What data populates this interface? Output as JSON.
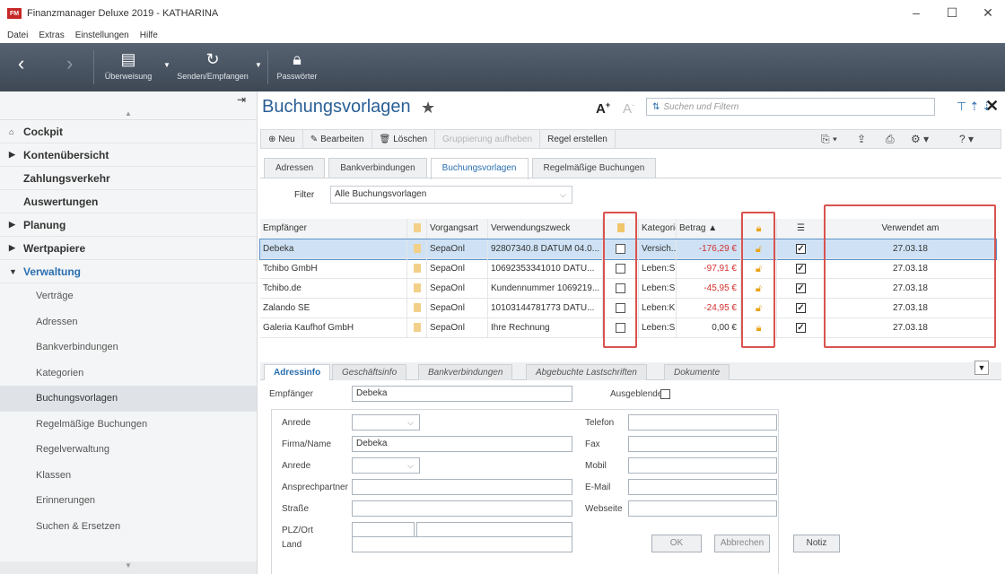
{
  "window": {
    "title": "Finanzmanager Deluxe 2019 - KATHARINA",
    "logo": "FM"
  },
  "menu": [
    "Datei",
    "Extras",
    "Einstellungen",
    "Hilfe"
  ],
  "toolbar": {
    "buttons": [
      {
        "label": "Überweisung",
        "icon": "transfer-icon"
      },
      {
        "label": "Senden/Empfangen",
        "icon": "sync-icon"
      },
      {
        "label": "Passwörter",
        "icon": "lock-icon"
      }
    ]
  },
  "sidebar": {
    "main": [
      {
        "label": "Cockpit",
        "icon": "home-icon"
      },
      {
        "label": "Kontenübersicht"
      },
      {
        "label": "Zahlungsverkehr"
      },
      {
        "label": "Auswertungen"
      },
      {
        "label": "Planung"
      },
      {
        "label": "Wertpapiere"
      },
      {
        "label": "Verwaltung"
      }
    ],
    "sub": [
      "Verträge",
      "Adressen",
      "Bankverbindungen",
      "Kategorien",
      "Buchungsvorlagen",
      "Regelmäßige Buchungen",
      "Regelverwaltung",
      "Klassen",
      "Erinnerungen",
      "Suchen & Ersetzen"
    ],
    "selected": "Buchungsvorlagen"
  },
  "page": {
    "title": "Buchungsvorlagen",
    "font_up": "A",
    "font_down": "A",
    "search_placeholder": "Suchen und Filtern"
  },
  "actions": {
    "new": "Neu",
    "edit": "Bearbeiten",
    "delete": "Löschen",
    "disabled": "Gruppierung aufheben",
    "rule": "Regel erstellen"
  },
  "tabs": [
    "Adressen",
    "Bankverbindungen",
    "Buchungsvorlagen",
    "Regelmäßige Buchungen"
  ],
  "active_tab": "Buchungsvorlagen",
  "filter": {
    "label": "Filter",
    "value": "Alle Buchungsvorlagen"
  },
  "table": {
    "headers": {
      "recipient": "Empfänger",
      "type": "Vorgangsart",
      "purpose": "Verwendungszweck",
      "category": "Kategorie",
      "amount": "Betrag ▲",
      "used": "Verwendet am"
    },
    "rows": [
      {
        "recipient": "Debeka",
        "type": "SepaOnl",
        "purpose": "92807340.8 DATUM 04.0...",
        "category": "Versich...",
        "amount": "-176,29 €",
        "used": "27.03.18",
        "locked": false
      },
      {
        "recipient": "Tchibo GmbH",
        "type": "SepaOnl",
        "purpose": "10692353341010 DATU...",
        "category": "Leben:S...",
        "amount": "-97,91 €",
        "used": "27.03.18",
        "locked": false
      },
      {
        "recipient": "Tchibo.de",
        "type": "SepaOnl",
        "purpose": "Kundennummer 1069219...",
        "category": "Leben:S...",
        "amount": "-45,95 €",
        "used": "27.03.18",
        "locked": false
      },
      {
        "recipient": "Zalando SE",
        "type": "SepaOnl",
        "purpose": "10103144781773 DATU...",
        "category": "Leben:K...",
        "amount": "-24,95 €",
        "used": "27.03.18",
        "locked": false
      },
      {
        "recipient": "Galeria Kaufhof GmbH",
        "type": "SepaOnl",
        "purpose": "Ihre Rechnung",
        "category": "Leben:S...",
        "amount": "0,00 €",
        "used": "27.03.18",
        "locked": true
      }
    ]
  },
  "detail": {
    "tabs": [
      "Adressinfo",
      "Geschäftsinfo",
      "Bankverbindungen",
      "Abgebuchte Lastschriften",
      "Dokumente"
    ],
    "fields": {
      "recipient_label": "Empfänger",
      "recipient_value": "Debeka",
      "hidden_label": "Ausgeblendet",
      "salutation_label": "Anrede",
      "company_label": "Firma/Name",
      "company_value": "Debeka",
      "salutation2_label": "Anrede",
      "contact_label": "Ansprechpartner",
      "street_label": "Straße",
      "zip_label": "PLZ/Ort",
      "country_label": "Land",
      "phone_label": "Telefon",
      "fax_label": "Fax",
      "mobile_label": "Mobil",
      "email_label": "E-Mail",
      "web_label": "Webseite"
    },
    "buttons": {
      "ok": "OK",
      "cancel": "Abbrechen",
      "note": "Notiz"
    }
  }
}
